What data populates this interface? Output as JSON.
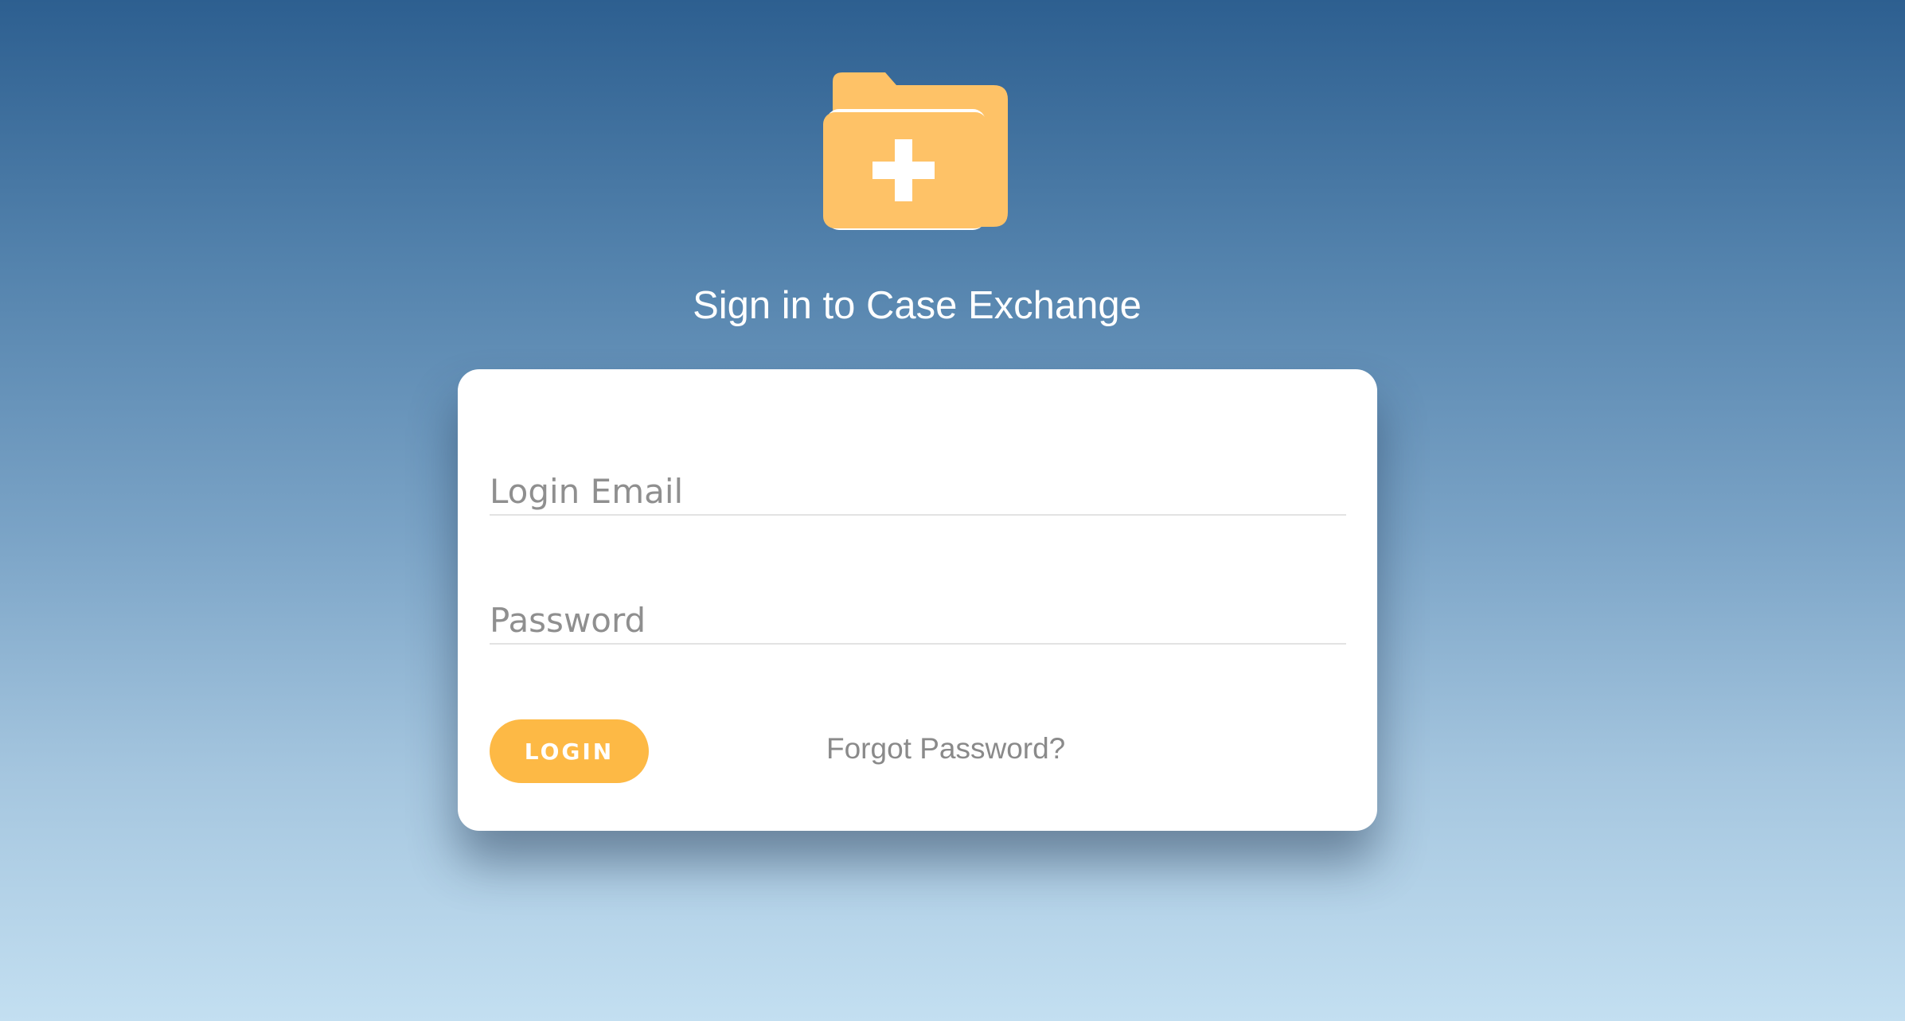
{
  "logo": {
    "icon": "medical-folder-icon",
    "folder_color": "#fec267",
    "cross_color": "#ffffff"
  },
  "page_title": "Sign in to Case Exchange",
  "form": {
    "email": {
      "placeholder": "Login Email",
      "value": ""
    },
    "password": {
      "placeholder": "Password",
      "value": ""
    },
    "login_label": "LOGIN",
    "forgot_label": "Forgot Password?"
  },
  "colors": {
    "accent": "#fdb945",
    "background_top": "#2d5f90",
    "background_bottom": "#c3dff1",
    "card": "#ffffff",
    "muted_text": "#8f8f8f"
  }
}
